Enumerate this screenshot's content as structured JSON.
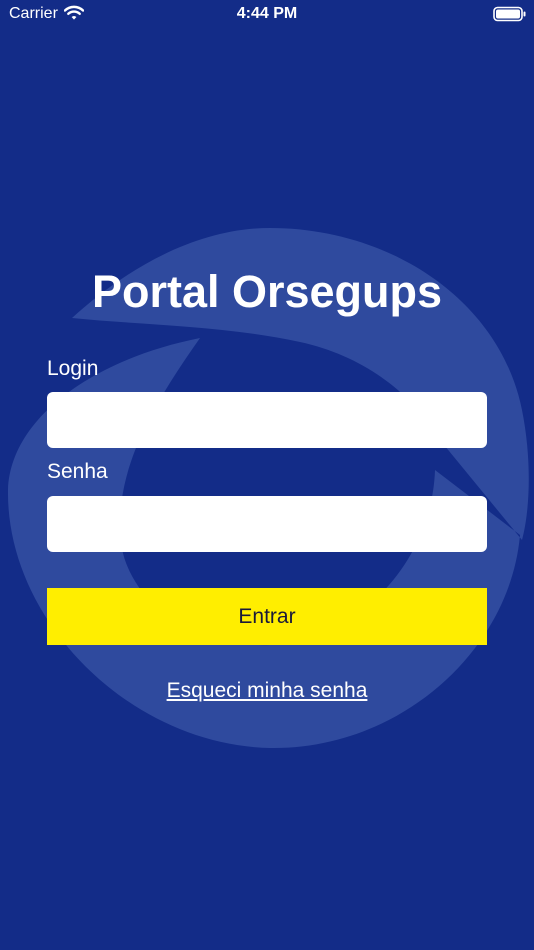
{
  "status_bar": {
    "carrier": "Carrier",
    "time": "4:44 PM",
    "wifi_icon": "wifi-icon",
    "battery_icon": "battery-full-icon"
  },
  "login": {
    "title": "Portal Orsegups",
    "login_label": "Login",
    "login_value": "",
    "password_label": "Senha",
    "password_value": "",
    "submit_label": "Entrar",
    "forgot_label": "Esqueci minha senha"
  },
  "colors": {
    "background": "#132c88",
    "button": "#ffee00",
    "emblem": "#2f4a9e"
  }
}
